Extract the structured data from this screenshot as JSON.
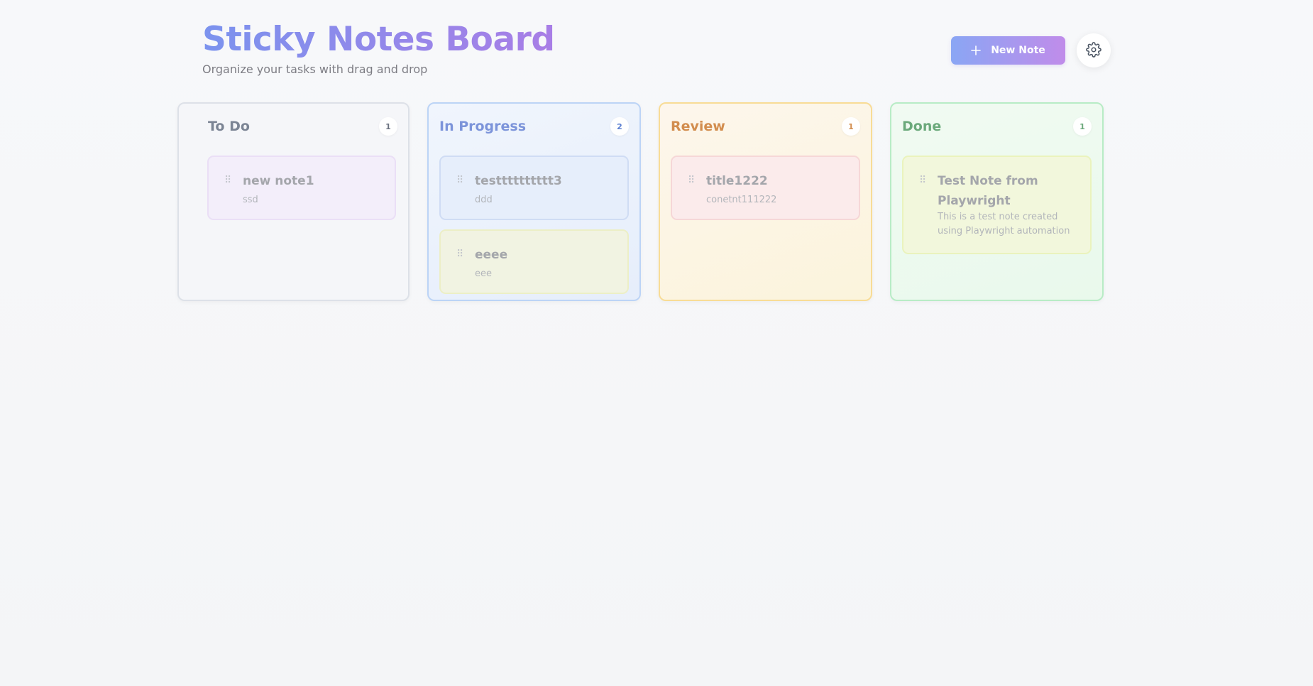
{
  "header": {
    "title": "Sticky Notes Board",
    "subtitle": "Organize your tasks with drag and drop"
  },
  "toolbar": {
    "new_note_label": "New Note",
    "new_note_icon": "plus-icon",
    "settings_icon": "gear-icon"
  },
  "columns": [
    {
      "title": "To Do",
      "count": "1",
      "accent": "#7b8494",
      "notes": [
        {
          "title": "new note1",
          "body": "ssd",
          "color": "#f3eefa"
        }
      ]
    },
    {
      "title": "In Progress",
      "count": "2",
      "accent": "#7c94da",
      "notes": [
        {
          "title": "testttttttttt3",
          "body": "ddd",
          "color": "#e6eefb"
        },
        {
          "title": "eeee",
          "body": "eee",
          "color": "#f1f3e2"
        }
      ]
    },
    {
      "title": "Review",
      "count": "1",
      "accent": "#d28d4e",
      "notes": [
        {
          "title": "title1222",
          "body": "conetnt111222",
          "color": "#fbebeb"
        }
      ]
    },
    {
      "title": "Done",
      "count": "1",
      "accent": "#6ba97b",
      "notes": [
        {
          "title": "Test Note from Playwright",
          "body": "This is a test note created using Playwright automation",
          "color": "#f2f7dc"
        }
      ]
    }
  ],
  "colors": {
    "title_gradient_start": "#7b93ee",
    "title_gradient_end": "#a97ee6",
    "button_gradient_start": "#8aa6f4",
    "button_gradient_end": "#c08cea"
  }
}
